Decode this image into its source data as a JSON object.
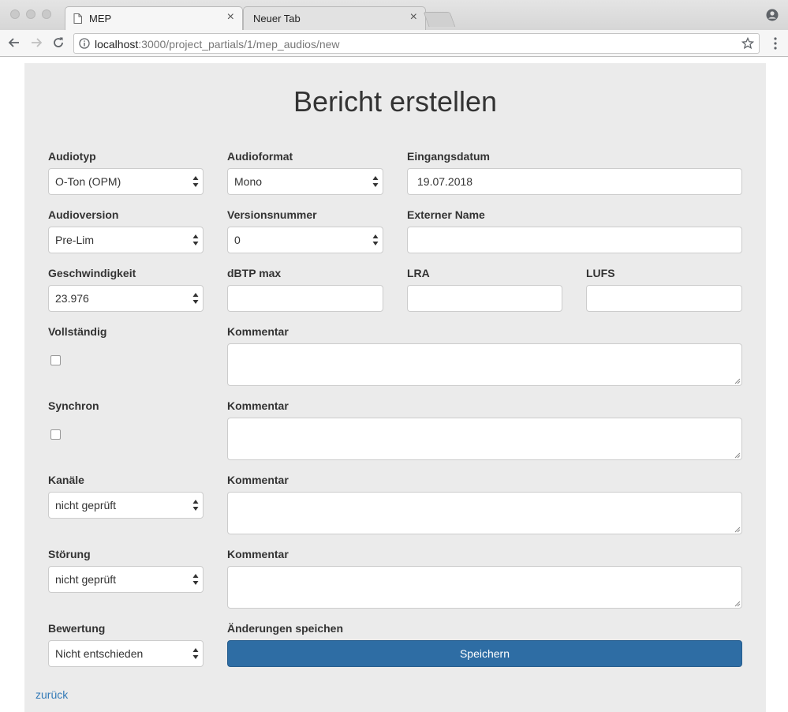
{
  "browser": {
    "tabs": [
      {
        "label": "MEP",
        "active": true
      },
      {
        "label": "Neuer Tab",
        "active": false
      }
    ],
    "url_host": "localhost",
    "url_path": ":3000/project_partials/1/mep_audios/new"
  },
  "page": {
    "title": "Bericht erstellen",
    "fields": {
      "audiotyp": {
        "label": "Audiotyp",
        "value": "O-Ton (OPM)"
      },
      "audioformat": {
        "label": "Audioformat",
        "value": "Mono"
      },
      "eingangsdatum": {
        "label": "Eingangsdatum",
        "value": "19.07.2018"
      },
      "audioversion": {
        "label": "Audioversion",
        "value": "Pre-Lim"
      },
      "versionsnummer": {
        "label": "Versionsnummer",
        "value": "0"
      },
      "externer_name": {
        "label": "Externer Name",
        "value": ""
      },
      "geschwindigkeit": {
        "label": "Geschwindigkeit",
        "value": "23.976"
      },
      "dbtp_max": {
        "label": "dBTP max",
        "value": ""
      },
      "lra": {
        "label": "LRA",
        "value": ""
      },
      "lufs": {
        "label": "LUFS",
        "value": ""
      },
      "vollstaendig": {
        "label": "Vollständig",
        "checked": false
      },
      "kommentar_1": {
        "label": "Kommentar",
        "value": ""
      },
      "synchron": {
        "label": "Synchron",
        "checked": false
      },
      "kommentar_2": {
        "label": "Kommentar",
        "value": ""
      },
      "kanaele": {
        "label": "Kanäle",
        "value": "nicht geprüft"
      },
      "kommentar_3": {
        "label": "Kommentar",
        "value": ""
      },
      "stoerung": {
        "label": "Störung",
        "value": "nicht geprüft"
      },
      "kommentar_4": {
        "label": "Kommentar",
        "value": ""
      },
      "bewertung": {
        "label": "Bewertung",
        "value": "Nicht entschieden"
      }
    },
    "save_label": "Änderungen speichen",
    "save_button": "Speichern",
    "back_link": "zurück"
  },
  "colors": {
    "page_bg": "#ebebeb",
    "primary_button": "#2e6da4",
    "link": "#337ab7"
  }
}
